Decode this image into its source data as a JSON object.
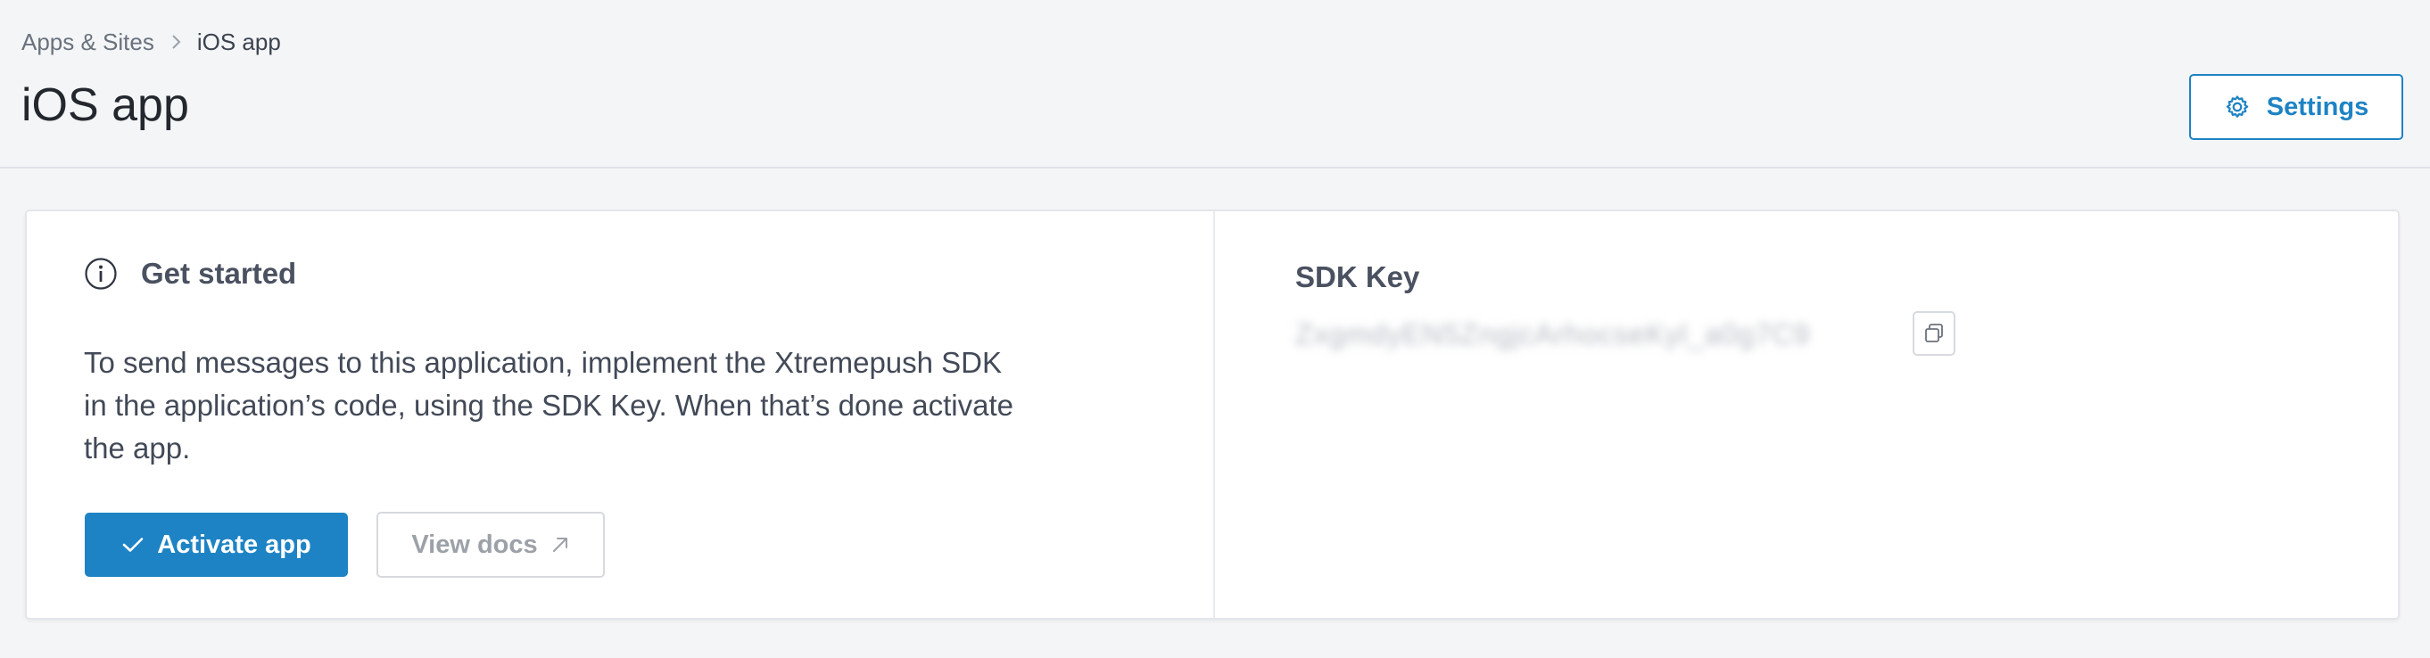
{
  "breadcrumb": {
    "parent": "Apps & Sites",
    "current": "iOS app"
  },
  "page": {
    "title": "iOS app",
    "settings_label": "Settings"
  },
  "get_started": {
    "heading": "Get started",
    "description": "To send messages to this application, implement the Xtremepush SDK in the application’s code, using the SDK Key. When that’s done activate the app.",
    "activate_label": "Activate app",
    "docs_label": "View docs"
  },
  "sdk": {
    "label": "SDK Key",
    "value": "ZxgmdyEN5ZngjcArhocseKyl_a0g7C9"
  },
  "icons": {
    "breadcrumb_separator": "chevron-right-icon",
    "settings": "gear-icon",
    "info": "info-icon",
    "activate": "check-icon",
    "docs": "external-link-icon",
    "copy": "copy-icon"
  },
  "colors": {
    "accent": "#1e83c4",
    "background": "#f4f5f7",
    "card": "#ffffff"
  }
}
